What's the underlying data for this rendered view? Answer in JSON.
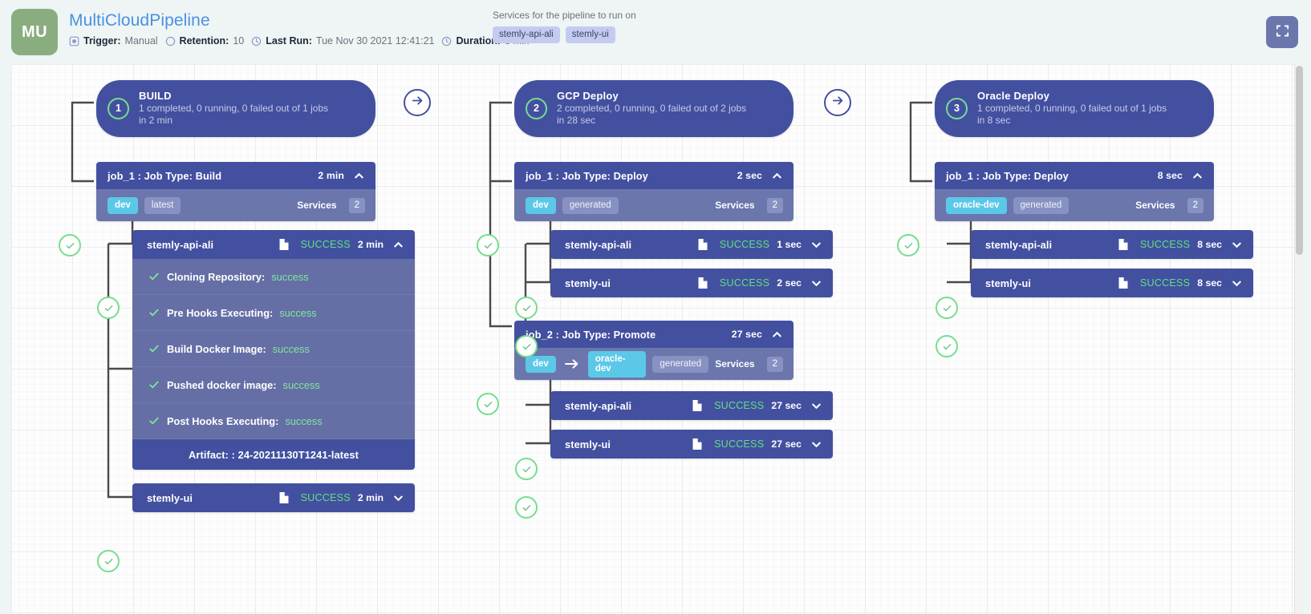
{
  "header": {
    "avatar_initials": "MU",
    "pipeline_title": "MultiCloudPipeline",
    "meta": [
      {
        "icon": "trigger-icon",
        "label": "Trigger:",
        "value": "Manual"
      },
      {
        "icon": "retention-icon",
        "label": "Retention:",
        "value": "10"
      },
      {
        "icon": "clock-icon",
        "label": "Last Run:",
        "value": "Tue Nov 30 2021 12:41:21"
      },
      {
        "icon": "duration-icon",
        "label": "Duration:",
        "value": "3 min"
      }
    ],
    "services_caption": "Services for the pipeline to run on",
    "service_chips": [
      "stemly-api-ali",
      "stemly-ui"
    ],
    "fullscreen_icon": "fullscreen-icon"
  },
  "colors": {
    "page_bg": "#eef5f4",
    "canvas_bg": "#fdfdfd",
    "node_primary": "#4350a0",
    "node_secondary": "#6b76ad",
    "env_chip": "#5bc8e8",
    "success_green": "#5ee07e",
    "status_ring": "#77dd8e",
    "title_link": "#4a90e2",
    "avatar": "#8aad80"
  },
  "stages": [
    {
      "number": "1",
      "name": "BUILD",
      "summary": "1 completed, 0 running, 0 failed out of 1 jobs",
      "duration_line": "in 2 min",
      "jobs": [
        {
          "title": "job_1 : Job Type: Build",
          "duration": "2 min",
          "expanded_icon": "chevron-up-icon",
          "tags": [
            {
              "text": "dev",
              "style": "env"
            },
            {
              "text": "latest",
              "style": "plain"
            }
          ],
          "promote_arrow": false,
          "services_label": "Services",
          "services_count": "2",
          "tasks": [
            {
              "name": "stemly-api-ali",
              "status": "SUCCESS",
              "duration": "2 min",
              "expanded": true,
              "chevron": "chevron-up-icon",
              "doc_icon": "document-icon",
              "steps": [
                {
                  "label": "Cloning Repository:",
                  "status": "success"
                },
                {
                  "label": "Pre Hooks Executing:",
                  "status": "success"
                },
                {
                  "label": "Build Docker Image:",
                  "status": "success"
                },
                {
                  "label": "Pushed docker image:",
                  "status": "success"
                },
                {
                  "label": "Post Hooks Executing:",
                  "status": "success"
                }
              ],
              "artifact": "Artifact: : 24-20211130T1241-latest"
            },
            {
              "name": "stemly-ui",
              "status": "SUCCESS",
              "duration": "2 min",
              "expanded": false,
              "chevron": "chevron-down-icon",
              "doc_icon": "document-icon",
              "steps": [],
              "artifact": ""
            }
          ]
        }
      ]
    },
    {
      "number": "2",
      "name": "GCP Deploy",
      "summary": "2 completed, 0 running, 0 failed out of 2 jobs",
      "duration_line": "in 28 sec",
      "jobs": [
        {
          "title": "job_1 : Job Type: Deploy",
          "duration": "2 sec",
          "expanded_icon": "chevron-up-icon",
          "tags": [
            {
              "text": "dev",
              "style": "env"
            },
            {
              "text": "generated",
              "style": "plain"
            }
          ],
          "promote_arrow": false,
          "services_label": "Services",
          "services_count": "2",
          "tasks": [
            {
              "name": "stemly-api-ali",
              "status": "SUCCESS",
              "duration": "1 sec",
              "expanded": false,
              "chevron": "chevron-down-icon",
              "doc_icon": "document-icon",
              "steps": [],
              "artifact": ""
            },
            {
              "name": "stemly-ui",
              "status": "SUCCESS",
              "duration": "2 sec",
              "expanded": false,
              "chevron": "chevron-down-icon",
              "doc_icon": "document-icon",
              "steps": [],
              "artifact": ""
            }
          ]
        },
        {
          "title": "job_2 : Job Type: Promote",
          "duration": "27 sec",
          "expanded_icon": "chevron-up-icon",
          "tags": [
            {
              "text": "dev",
              "style": "env"
            },
            {
              "text": "oracle-dev",
              "style": "env"
            },
            {
              "text": "generated",
              "style": "plain"
            }
          ],
          "promote_arrow": true,
          "promote_arrow_icon": "arrow-right-icon",
          "services_label": "Services",
          "services_count": "2",
          "tasks": [
            {
              "name": "stemly-api-ali",
              "status": "SUCCESS",
              "duration": "27 sec",
              "expanded": false,
              "chevron": "chevron-down-icon",
              "doc_icon": "document-icon",
              "steps": [],
              "artifact": ""
            },
            {
              "name": "stemly-ui",
              "status": "SUCCESS",
              "duration": "27 sec",
              "expanded": false,
              "chevron": "chevron-down-icon",
              "doc_icon": "document-icon",
              "steps": [],
              "artifact": ""
            }
          ]
        }
      ]
    },
    {
      "number": "3",
      "name": "Oracle Deploy",
      "summary": "1 completed, 0 running, 0 failed out of 1 jobs",
      "duration_line": "in 8 sec",
      "jobs": [
        {
          "title": "job_1 : Job Type: Deploy",
          "duration": "8 sec",
          "expanded_icon": "chevron-up-icon",
          "tags": [
            {
              "text": "oracle-dev",
              "style": "env"
            },
            {
              "text": "generated",
              "style": "plain"
            }
          ],
          "promote_arrow": false,
          "services_label": "Services",
          "services_count": "2",
          "tasks": [
            {
              "name": "stemly-api-ali",
              "status": "SUCCESS",
              "duration": "8 sec",
              "expanded": false,
              "chevron": "chevron-down-icon",
              "doc_icon": "document-icon",
              "steps": [],
              "artifact": ""
            },
            {
              "name": "stemly-ui",
              "status": "SUCCESS",
              "duration": "8 sec",
              "expanded": false,
              "chevron": "chevron-down-icon",
              "doc_icon": "document-icon",
              "steps": [],
              "artifact": ""
            }
          ]
        }
      ]
    }
  ],
  "connectors": [
    {
      "name": "stage-1-to-2-arrow",
      "icon": "arrow-right-icon"
    },
    {
      "name": "stage-2-to-3-arrow",
      "icon": "arrow-right-icon"
    }
  ]
}
